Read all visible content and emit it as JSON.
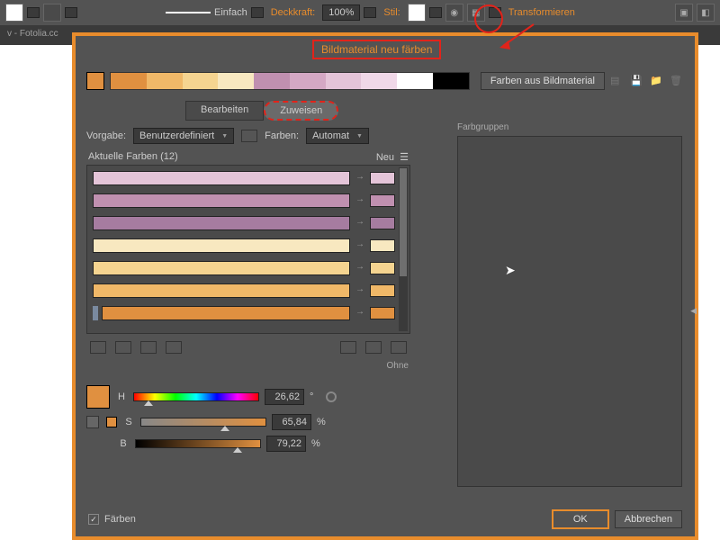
{
  "toolbar": {
    "stroke_style": "Einfach",
    "opacity_label": "Deckkraft:",
    "opacity_value": "100%",
    "style_label": "Stil:",
    "transform_label": "Transformieren"
  },
  "tab_title": "v - Fotolia.cc",
  "dialog": {
    "title": "Bildmaterial neu färben",
    "button_from_artwork": "Farben aus Bildmaterial",
    "tab_edit": "Bearbeiten",
    "tab_assign": "Zuweisen",
    "preset_label": "Vorgabe:",
    "preset_value": "Benutzerdefiniert",
    "colors_label": "Farben:",
    "colors_value": "Automat",
    "current_colors_label": "Aktuelle Farben (12)",
    "new_label": "Neu",
    "colorgroups_label": "Farbgruppen",
    "none_label": "Ohne",
    "hsb": {
      "h_label": "H",
      "h_value": "26,62",
      "h_unit": "°",
      "s_label": "S",
      "s_value": "65,84",
      "s_unit": "%",
      "b_label": "B",
      "b_value": "79,22",
      "b_unit": "%"
    },
    "recolor_checkbox": "Färben",
    "ok": "OK",
    "cancel": "Abbrechen"
  },
  "strip_colors": [
    "#e09040",
    "#f0b868",
    "#f5d490",
    "#f8e8c0",
    "#c090b0",
    "#d4a8c4",
    "#e4c4d8",
    "#f0d8e8",
    "#ffffff",
    "#000000"
  ],
  "color_rows": [
    {
      "bar": "#e09040",
      "chip": "#e09040"
    },
    {
      "bar": "#f0b868",
      "chip": "#f0b868"
    },
    {
      "bar": "#f5d490",
      "chip": "#f5d490"
    },
    {
      "bar": "#f8e8c0",
      "chip": "#f8e8c0"
    },
    {
      "bar": "#a67ca0",
      "chip": "#a67ca0"
    },
    {
      "bar": "#c090b0",
      "chip": "#c090b0"
    },
    {
      "bar": "#e4c4d8",
      "chip": "#e4c4d8"
    }
  ]
}
